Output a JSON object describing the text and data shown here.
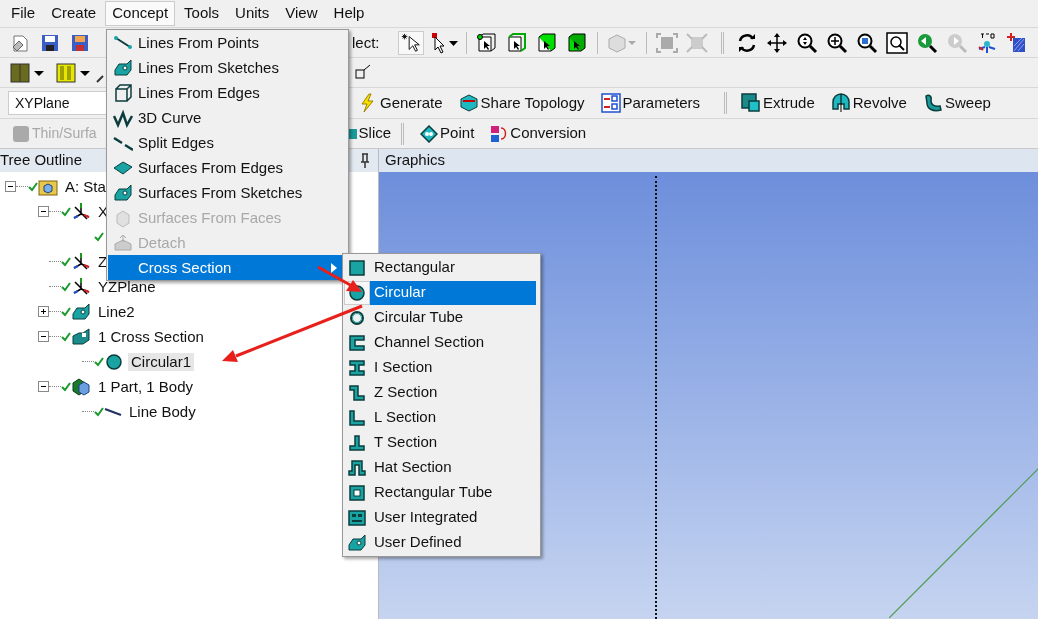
{
  "menu_bar": [
    {
      "label": "File",
      "selected": false
    },
    {
      "label": "Create",
      "selected": false
    },
    {
      "label": "Concept",
      "selected": true
    },
    {
      "label": "Tools",
      "selected": false
    },
    {
      "label": "Units",
      "selected": false
    },
    {
      "label": "View",
      "selected": false
    },
    {
      "label": "Help",
      "selected": false
    }
  ],
  "select_toolbar": {
    "label": "lect:"
  },
  "plane_field": {
    "value": "XYPlane"
  },
  "feature_toolbar": [
    {
      "label": "Generate",
      "kind": "generate"
    },
    {
      "label": "Share Topology",
      "kind": "share"
    },
    {
      "label": "Parameters",
      "kind": "parameters"
    },
    {
      "label": "Extrude",
      "kind": "extrude"
    },
    {
      "label": "Revolve",
      "kind": "revolve"
    },
    {
      "label": "Sweep",
      "kind": "sweep"
    }
  ],
  "tools_toolbar": [
    {
      "label": "Thin/Surfa",
      "kind": "thin",
      "disabled": true
    },
    {
      "label": "Slice",
      "kind": "slice",
      "disabled": false
    },
    {
      "label": "Point",
      "kind": "point",
      "disabled": false
    },
    {
      "label": "Conversion",
      "kind": "conversion",
      "disabled": false
    }
  ],
  "tree_outline": {
    "title": "Tree Outline",
    "nodes": [
      {
        "label": "A: Sta",
        "kind": "geometry",
        "expanded": true,
        "selected": false,
        "children": [
          {
            "label": "X",
            "kind": "plane",
            "expanded": true,
            "selected": false
          },
          {
            "label": "Z",
            "kind": "plane",
            "selected": false
          },
          {
            "label": "YZPlane",
            "kind": "plane",
            "selected": false
          },
          {
            "label": "Line2",
            "kind": "sketch",
            "expanded": false,
            "selected": false
          },
          {
            "label": "1 Cross Section",
            "kind": "cross_section",
            "expanded": true,
            "selected": false,
            "children": [
              {
                "label": "Circular1",
                "kind": "circular",
                "selected": true
              }
            ]
          },
          {
            "label": "1 Part, 1 Body",
            "kind": "part",
            "expanded": true,
            "selected": false,
            "children": [
              {
                "label": "Line Body",
                "kind": "line_body",
                "selected": false
              }
            ]
          }
        ]
      }
    ]
  },
  "graphics": {
    "title": "Graphics"
  },
  "concept_menu": [
    {
      "label": "Lines From Points",
      "kind": "line_points",
      "disabled": false,
      "selected": false,
      "has_submenu": false
    },
    {
      "label": "Lines From Sketches",
      "kind": "sketch",
      "disabled": false,
      "selected": false,
      "has_submenu": false
    },
    {
      "label": "Lines From Edges",
      "kind": "edges",
      "disabled": false,
      "selected": false,
      "has_submenu": false
    },
    {
      "label": "3D Curve",
      "kind": "curve",
      "disabled": false,
      "selected": false,
      "has_submenu": false
    },
    {
      "label": "Split Edges",
      "kind": "split",
      "disabled": false,
      "selected": false,
      "has_submenu": false
    },
    {
      "label": "Surfaces From Edges",
      "kind": "surface",
      "disabled": false,
      "selected": false,
      "has_submenu": false
    },
    {
      "label": "Surfaces From Sketches",
      "kind": "sketch",
      "disabled": false,
      "selected": false,
      "has_submenu": false
    },
    {
      "label": "Surfaces From Faces",
      "kind": "faces",
      "disabled": true,
      "selected": false,
      "has_submenu": false
    },
    {
      "label": "Detach",
      "kind": "detach",
      "disabled": true,
      "selected": false,
      "has_submenu": false
    },
    {
      "label": "Cross Section",
      "kind": "none",
      "disabled": false,
      "selected": true,
      "has_submenu": true
    }
  ],
  "cross_section_menu": [
    {
      "label": "Rectangular",
      "kind": "rect",
      "selected": false
    },
    {
      "label": "Circular",
      "kind": "circle",
      "selected": true
    },
    {
      "label": "Circular Tube",
      "kind": "tube",
      "selected": false
    },
    {
      "label": "Channel Section",
      "kind": "channel",
      "selected": false
    },
    {
      "label": "I Section",
      "kind": "i",
      "selected": false
    },
    {
      "label": "Z Section",
      "kind": "z",
      "selected": false
    },
    {
      "label": "L Section",
      "kind": "l",
      "selected": false
    },
    {
      "label": "T Section",
      "kind": "t",
      "selected": false
    },
    {
      "label": "Hat Section",
      "kind": "hat",
      "selected": false
    },
    {
      "label": "Rectangular Tube",
      "kind": "rect_tube",
      "selected": false
    },
    {
      "label": "User Integrated",
      "kind": "user_integrated",
      "selected": false
    },
    {
      "label": "User Defined",
      "kind": "sketch",
      "selected": false
    }
  ]
}
